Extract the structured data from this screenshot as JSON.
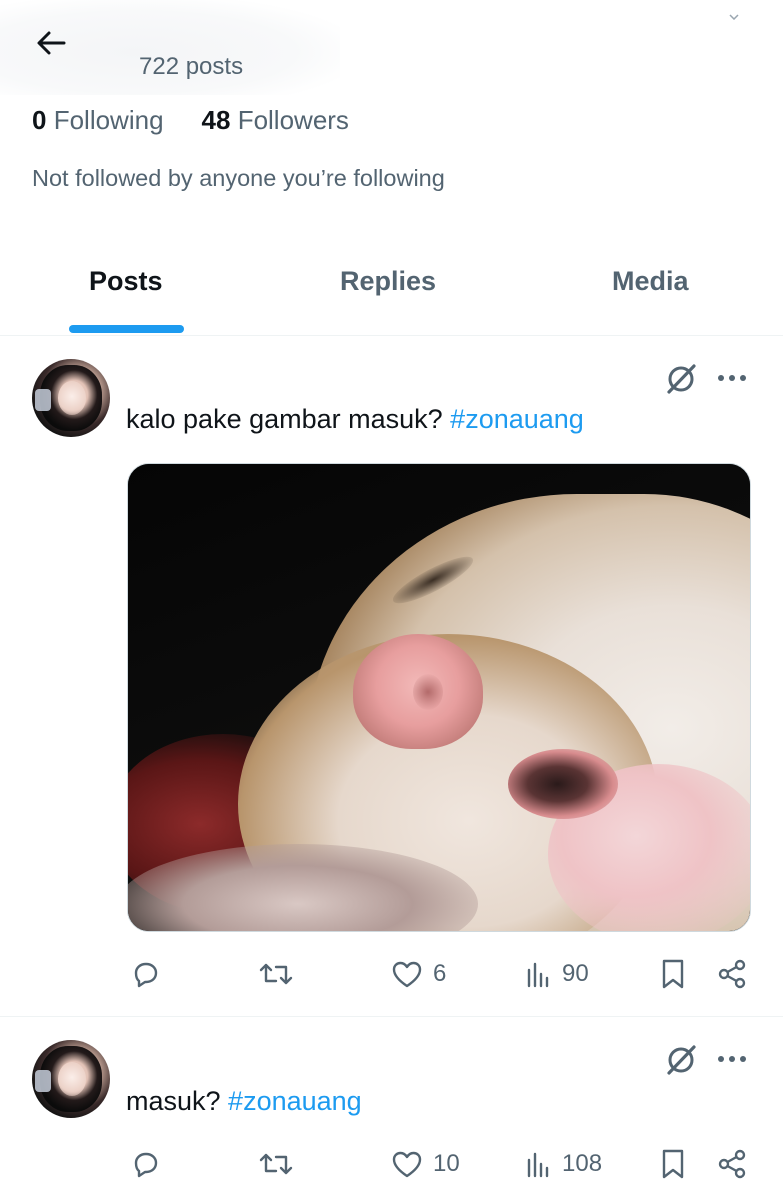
{
  "profile": {
    "post_count": "722 posts",
    "following_count": "0",
    "following_label": "Following",
    "followers_count": "48",
    "followers_label": "Followers",
    "not_followed_text": "Not followed by anyone you’re following"
  },
  "tabs": [
    {
      "label": "Posts",
      "active": true
    },
    {
      "label": "Replies",
      "active": false
    },
    {
      "label": "Media",
      "active": false
    }
  ],
  "posts": [
    {
      "text": "kalo pake gambar masuk? ",
      "hashtag": "#zonauang",
      "has_media": true,
      "replies": "",
      "reposts": "",
      "likes": "6",
      "views": "90"
    },
    {
      "text": "masuk? ",
      "hashtag": "#zonauang",
      "has_media": false,
      "replies": "",
      "reposts": "",
      "likes": "10",
      "views": "108"
    }
  ],
  "icons": {
    "back": "arrow-left-icon",
    "grok": "grok-icon",
    "more": "more-icon",
    "reply": "reply-icon",
    "repost": "repost-icon",
    "like": "heart-icon",
    "views": "views-icon",
    "bookmark": "bookmark-icon",
    "share": "share-icon"
  },
  "colors": {
    "accent": "#1d9bf0",
    "text_primary": "#0f1419",
    "text_secondary": "#536471"
  }
}
